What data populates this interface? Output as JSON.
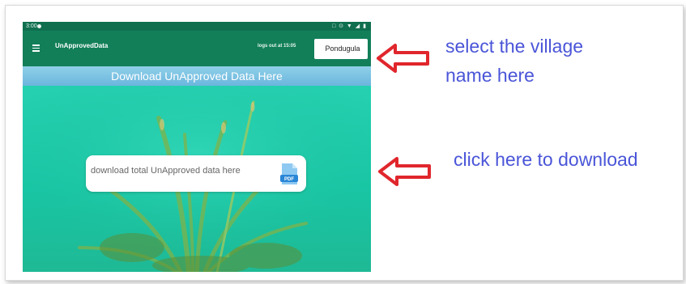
{
  "status_bar": {
    "time": "3:00",
    "system_icons": "□ ⊙ ▼ ◢ ▮"
  },
  "app_bar": {
    "title": "UnApprovedData",
    "logout_text": "logs out at 15:05",
    "village_selected": "Pondugula"
  },
  "banner": {
    "text": "Download UnApproved Data Here"
  },
  "download_card": {
    "label": "download total UnApproved data here",
    "icon": "pdf-file-icon",
    "icon_text": "PDF"
  },
  "annotations": {
    "select_line1": "select the village",
    "select_line2": "name here",
    "download_hint": "click here to download"
  },
  "colors": {
    "status_bar": "#0f6f4e",
    "app_bar": "#127f59",
    "banner": "#7cc3e4",
    "background": "#1ec7a7",
    "annotation_text": "#4a55d8",
    "arrow": "#e0262c"
  }
}
